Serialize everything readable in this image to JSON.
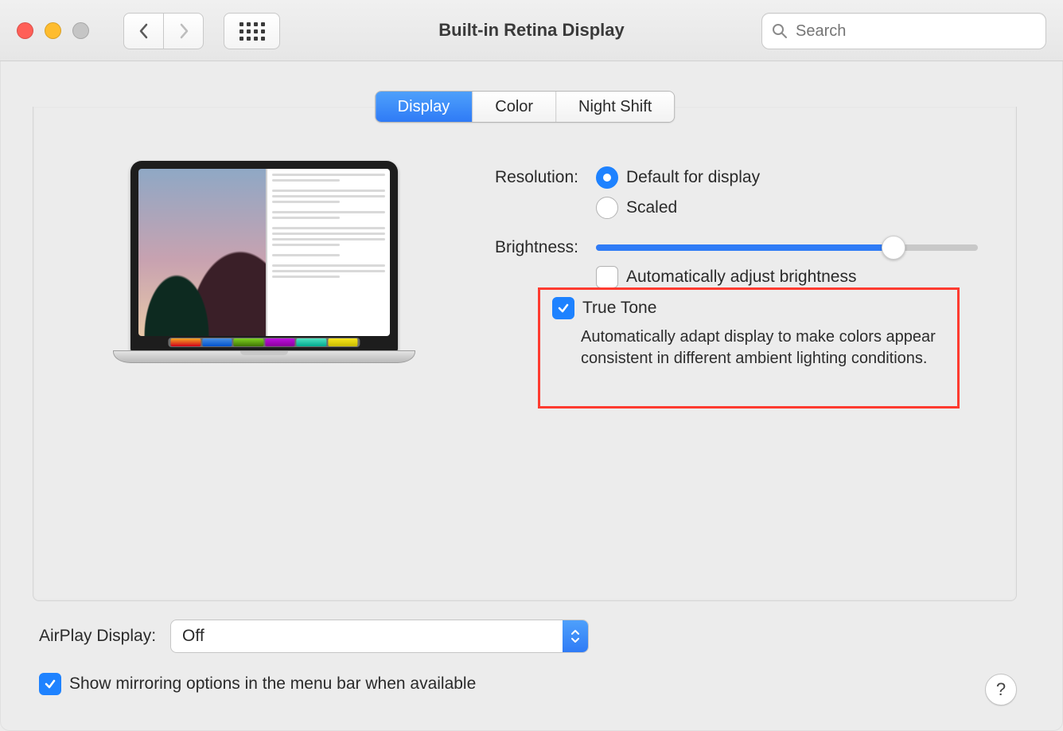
{
  "window": {
    "title": "Built-in Retina Display"
  },
  "search": {
    "placeholder": "Search"
  },
  "tabs": {
    "display": "Display",
    "color": "Color",
    "night_shift": "Night Shift"
  },
  "resolution": {
    "label": "Resolution:",
    "default_option": "Default for display",
    "scaled_option": "Scaled"
  },
  "brightness": {
    "label": "Brightness:",
    "auto_label": "Automatically adjust brightness"
  },
  "true_tone": {
    "label": "True Tone",
    "description": "Automatically adapt display to make colors appear consistent in different ambient lighting conditions."
  },
  "airplay": {
    "label": "AirPlay Display:",
    "value": "Off"
  },
  "mirroring": {
    "label": "Show mirroring options in the menu bar when available"
  },
  "help": {
    "label": "?"
  }
}
